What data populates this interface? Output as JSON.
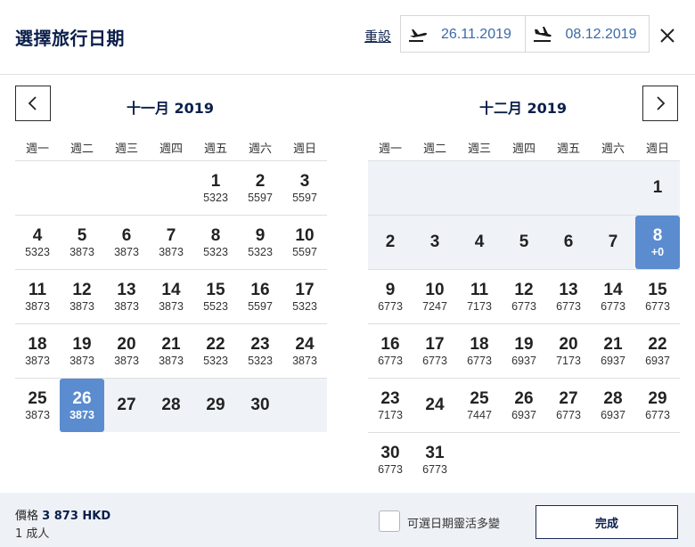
{
  "header": {
    "title": "選擇旅行日期",
    "reset_label": "重設",
    "depart_date": "26.11.2019",
    "return_date": "08.12.2019"
  },
  "weekdays": [
    "週一",
    "週二",
    "週三",
    "週四",
    "週五",
    "週六",
    "週日"
  ],
  "months": [
    {
      "title": "十一月 2019",
      "weeks": [
        [
          null,
          null,
          null,
          null,
          {
            "d": "1",
            "p": "5323"
          },
          {
            "d": "2",
            "p": "5597"
          },
          {
            "d": "3",
            "p": "5597"
          }
        ],
        [
          {
            "d": "4",
            "p": "5323"
          },
          {
            "d": "5",
            "p": "3873"
          },
          {
            "d": "6",
            "p": "3873"
          },
          {
            "d": "7",
            "p": "3873"
          },
          {
            "d": "8",
            "p": "5323"
          },
          {
            "d": "9",
            "p": "5323"
          },
          {
            "d": "10",
            "p": "5597"
          }
        ],
        [
          {
            "d": "11",
            "p": "3873"
          },
          {
            "d": "12",
            "p": "3873"
          },
          {
            "d": "13",
            "p": "3873"
          },
          {
            "d": "14",
            "p": "3873"
          },
          {
            "d": "15",
            "p": "5523"
          },
          {
            "d": "16",
            "p": "5597"
          },
          {
            "d": "17",
            "p": "5323"
          }
        ],
        [
          {
            "d": "18",
            "p": "3873"
          },
          {
            "d": "19",
            "p": "3873"
          },
          {
            "d": "20",
            "p": "3873"
          },
          {
            "d": "21",
            "p": "3873"
          },
          {
            "d": "22",
            "p": "5323"
          },
          {
            "d": "23",
            "p": "5323"
          },
          {
            "d": "24",
            "p": "3873"
          }
        ],
        [
          {
            "d": "25",
            "p": "3873"
          },
          {
            "d": "26",
            "p": "3873",
            "s": "sel"
          },
          {
            "d": "27",
            "p": "",
            "s": "range"
          },
          {
            "d": "28",
            "p": "",
            "s": "range"
          },
          {
            "d": "29",
            "p": "",
            "s": "range"
          },
          {
            "d": "30",
            "p": "",
            "s": "range"
          },
          {
            "s": "range-empty"
          }
        ]
      ]
    },
    {
      "title": "十二月 2019",
      "weeks": [
        [
          {
            "s": "range-empty"
          },
          {
            "s": "range-empty"
          },
          {
            "s": "range-empty"
          },
          {
            "s": "range-empty"
          },
          {
            "s": "range-empty"
          },
          {
            "s": "range-empty"
          },
          {
            "d": "1",
            "p": "",
            "s": "range"
          }
        ],
        [
          {
            "d": "2",
            "p": "",
            "s": "range"
          },
          {
            "d": "3",
            "p": "",
            "s": "range"
          },
          {
            "d": "4",
            "p": "",
            "s": "range"
          },
          {
            "d": "5",
            "p": "",
            "s": "range"
          },
          {
            "d": "6",
            "p": "",
            "s": "range"
          },
          {
            "d": "7",
            "p": "",
            "s": "range"
          },
          {
            "d": "8",
            "p": "+0",
            "s": "sel"
          }
        ],
        [
          {
            "d": "9",
            "p": "6773"
          },
          {
            "d": "10",
            "p": "7247"
          },
          {
            "d": "11",
            "p": "7173"
          },
          {
            "d": "12",
            "p": "6773"
          },
          {
            "d": "13",
            "p": "6773"
          },
          {
            "d": "14",
            "p": "6773"
          },
          {
            "d": "15",
            "p": "6773"
          }
        ],
        [
          {
            "d": "16",
            "p": "6773"
          },
          {
            "d": "17",
            "p": "6773"
          },
          {
            "d": "18",
            "p": "6773"
          },
          {
            "d": "19",
            "p": "6937"
          },
          {
            "d": "20",
            "p": "7173"
          },
          {
            "d": "21",
            "p": "6937"
          },
          {
            "d": "22",
            "p": "6937"
          }
        ],
        [
          {
            "d": "23",
            "p": "7173"
          },
          {
            "d": "24",
            "p": ""
          },
          {
            "d": "25",
            "p": "7447"
          },
          {
            "d": "26",
            "p": "6937"
          },
          {
            "d": "27",
            "p": "6773"
          },
          {
            "d": "28",
            "p": "6937"
          },
          {
            "d": "29",
            "p": "6773"
          }
        ],
        [
          {
            "d": "30",
            "p": "6773"
          },
          {
            "d": "31",
            "p": "6773"
          },
          null,
          null,
          null,
          null,
          null
        ]
      ]
    }
  ],
  "footer": {
    "price_prefix": "價格",
    "price_value": "3 873 HKD",
    "pax": "1 成人",
    "flex_label": "可選日期靈活多變",
    "done_label": "完成"
  },
  "colors": {
    "accent": "#5a8ccf",
    "range": "#eff3f7",
    "navy": "#0b1f4b"
  },
  "icons": {
    "depart": "plane-takeoff-icon",
    "return": "plane-landing-icon",
    "close": "close-icon",
    "prev": "chevron-left-icon",
    "next": "chevron-right-icon"
  }
}
